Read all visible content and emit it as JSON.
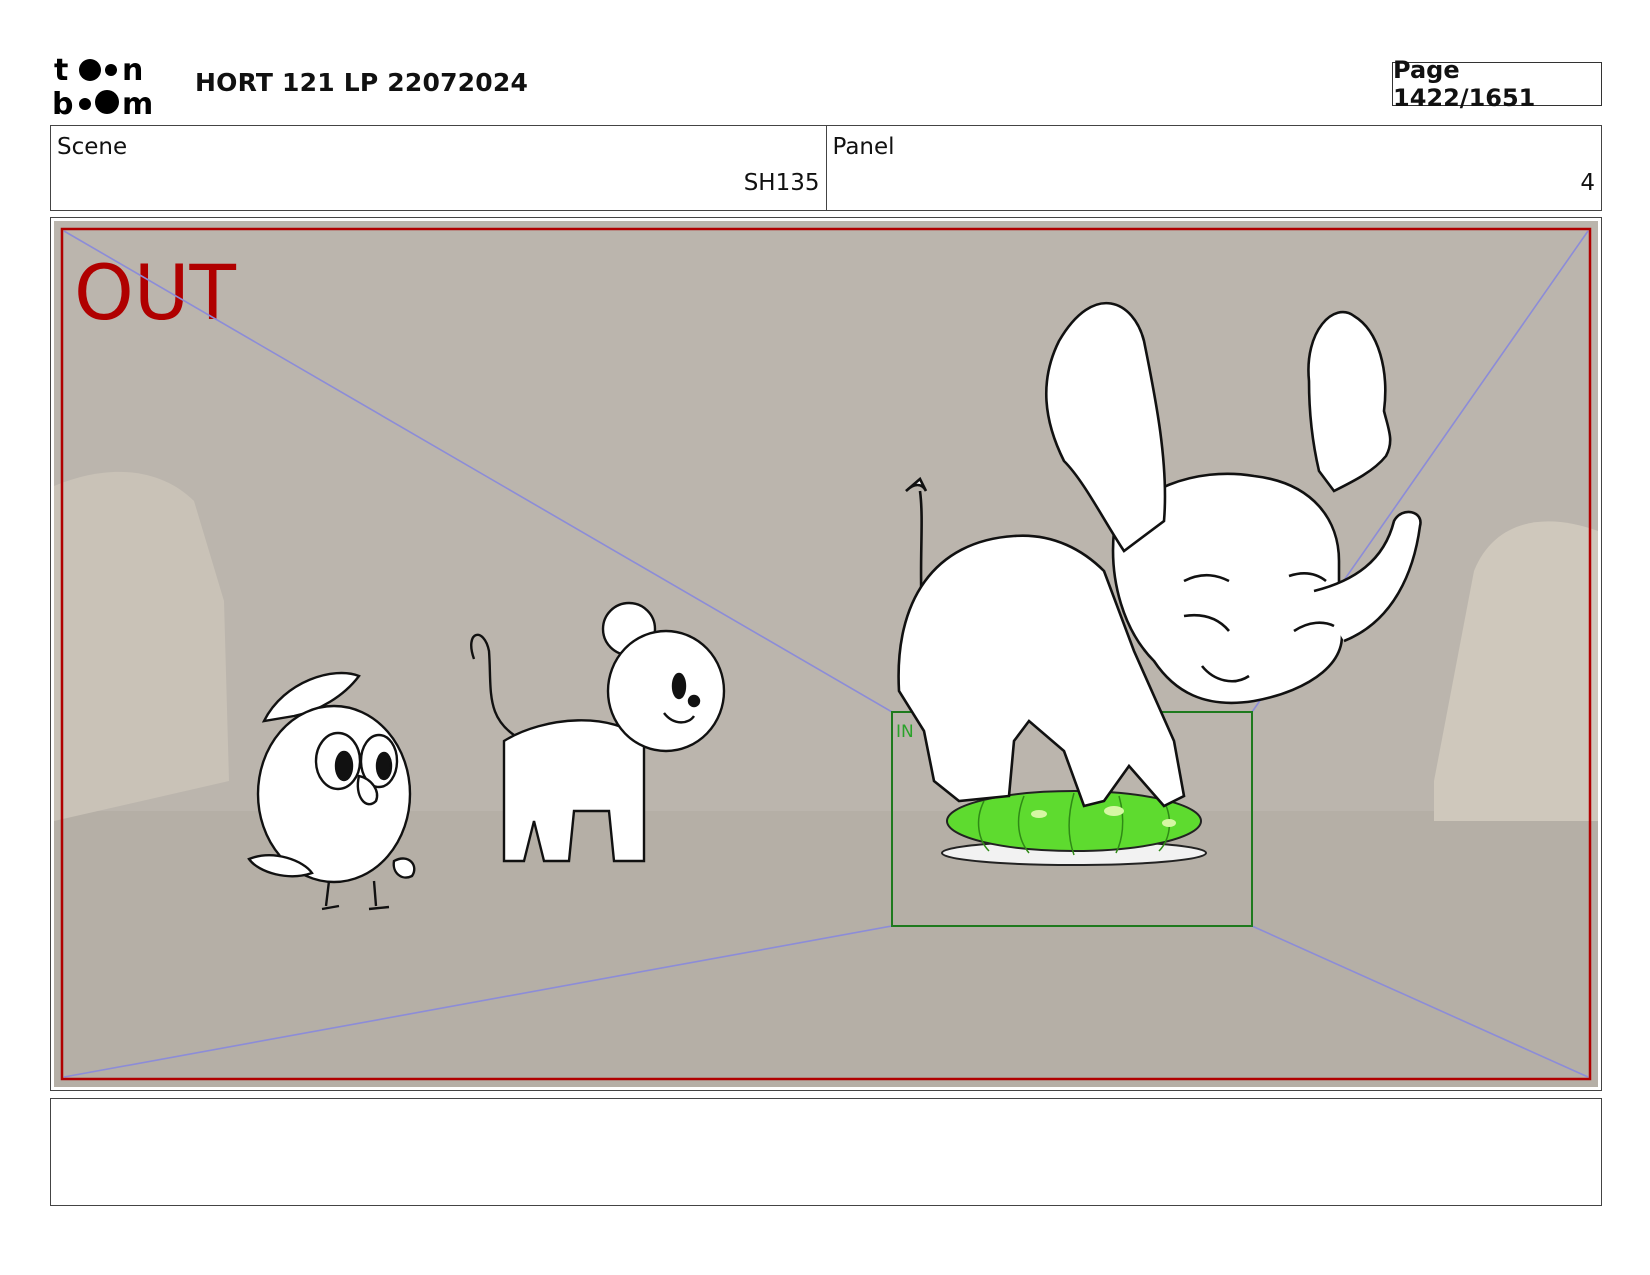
{
  "header": {
    "logo_text": "toon boom",
    "title": "HORT 121 LP 22072024",
    "page_label": "Page 1422/1651"
  },
  "info": {
    "scene_label": "Scene",
    "scene_value": "SH135",
    "panel_label": "Panel",
    "panel_value": "4"
  },
  "panel": {
    "out_label": "OUT",
    "in_label": "IN",
    "colors": {
      "background": "#bbb5ad",
      "out_frame": "#b00000",
      "in_frame": "#1e7a1e",
      "perspective_lines": "#8c8cd8",
      "cushion": "#5edb2f"
    }
  },
  "notes": {
    "text": ""
  }
}
